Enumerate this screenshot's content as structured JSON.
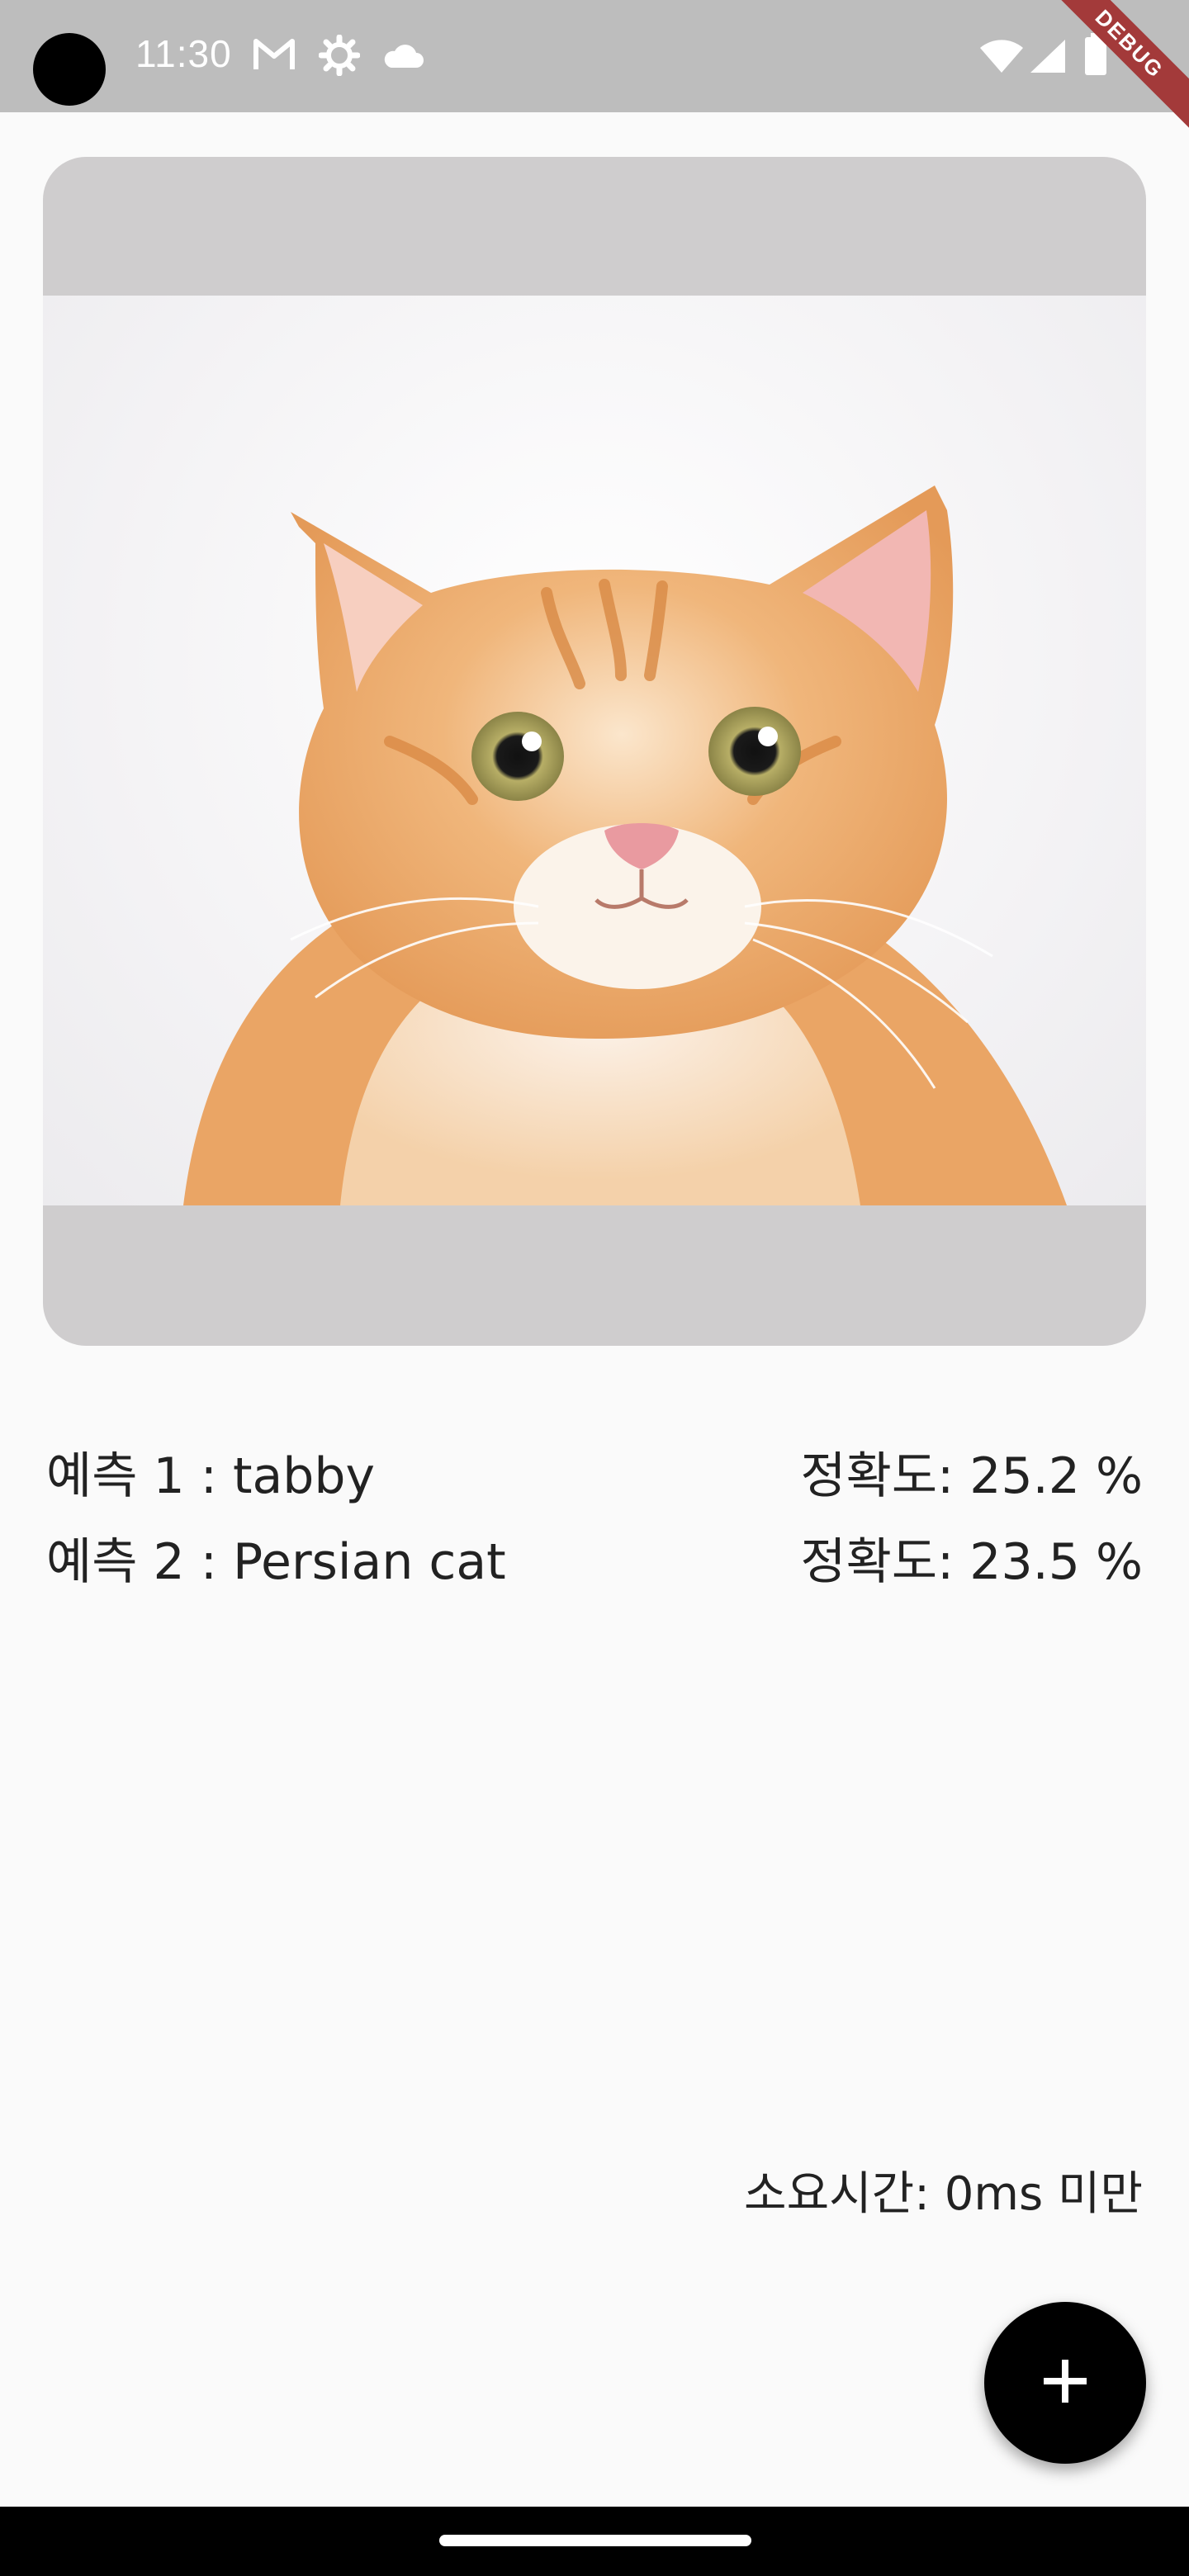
{
  "status_bar": {
    "time": "11:30",
    "left_icons": [
      "gmail-icon",
      "settings-icon",
      "cloud-icon"
    ],
    "right_icons": [
      "wifi-icon",
      "signal-icon",
      "battery-icon"
    ],
    "debug_banner": "DEBUG"
  },
  "image_card": {
    "image_subject": "orange tabby cat",
    "icon": "cat-photo"
  },
  "predictions": [
    {
      "label": "예측 1 : tabby",
      "accuracy": "정확도: 25.2 %"
    },
    {
      "label": "예측 2 : Persian cat",
      "accuracy": "정확도: 23.5 %"
    }
  ],
  "elapsed_time": "소요시간: 0ms 미만",
  "fab": {
    "icon": "plus-icon"
  },
  "colors": {
    "status_bar_bg": "#bdbdbd",
    "page_bg": "#fafafa",
    "card_bg": "#cfcdce",
    "fab_bg": "#000000",
    "debug_ribbon": "#a33a3a"
  }
}
